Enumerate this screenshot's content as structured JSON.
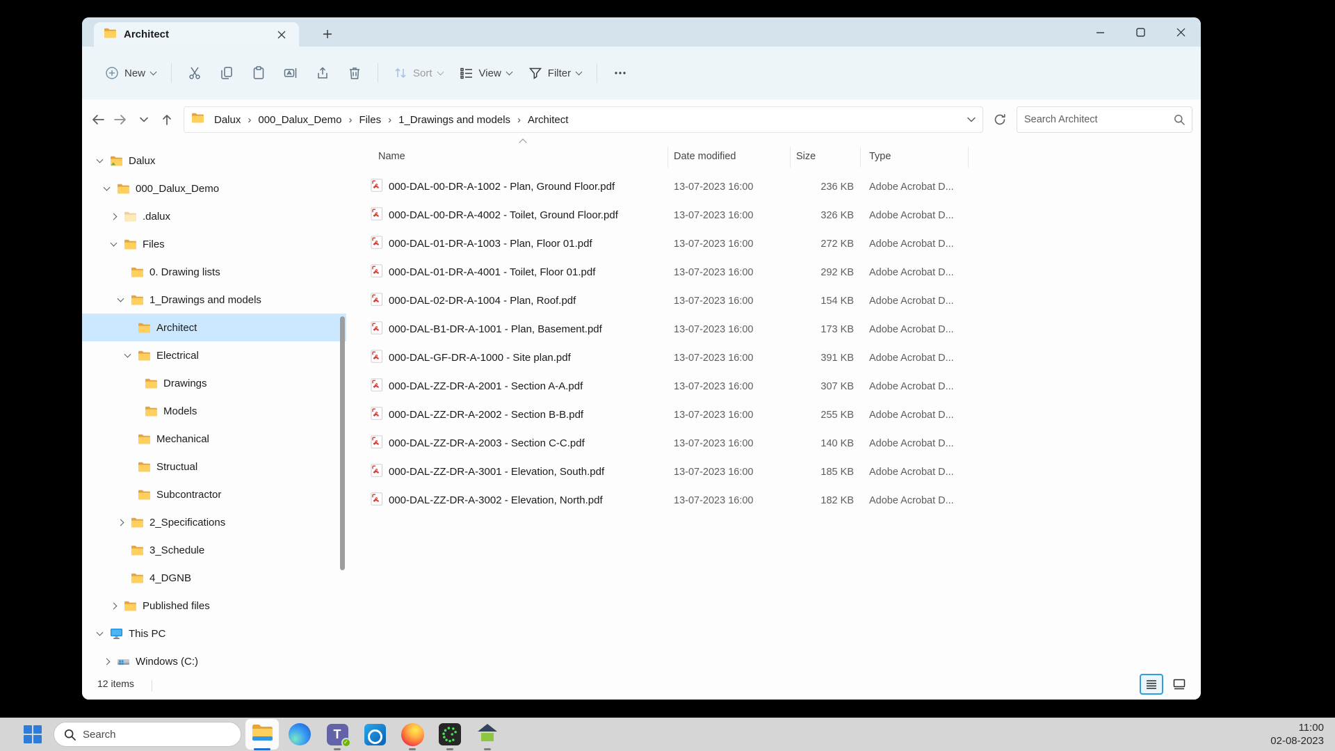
{
  "window": {
    "tab_title": "Architect",
    "new_tab_label": "+",
    "controls": {
      "minimize": "minimize",
      "maximize": "maximize",
      "close": "close"
    }
  },
  "toolbar": {
    "new_label": "New",
    "sort_label": "Sort",
    "view_label": "View",
    "filter_label": "Filter"
  },
  "addressbar": {
    "breadcrumb": [
      "Dalux",
      "000_Dalux_Demo",
      "Files",
      "1_Drawings and models",
      "Architect"
    ],
    "separator": "›",
    "search_placeholder": "Search Architect"
  },
  "sidebar": {
    "items": [
      {
        "label": "Dalux",
        "level": 0,
        "chevron": "down",
        "icon": "folder-sync",
        "selected": false
      },
      {
        "label": "000_Dalux_Demo",
        "level": 1,
        "chevron": "down",
        "icon": "folder",
        "selected": false
      },
      {
        "label": ".dalux",
        "level": 2,
        "chevron": "right",
        "icon": "folder-light",
        "selected": false
      },
      {
        "label": "Files",
        "level": 2,
        "chevron": "down",
        "icon": "folder",
        "selected": false
      },
      {
        "label": "0. Drawing lists",
        "level": 3,
        "chevron": "none",
        "icon": "folder",
        "selected": false
      },
      {
        "label": "1_Drawings and models",
        "level": 3,
        "chevron": "down",
        "icon": "folder",
        "selected": false
      },
      {
        "label": "Architect",
        "level": 4,
        "chevron": "none",
        "icon": "folder",
        "selected": true
      },
      {
        "label": "Electrical",
        "level": 4,
        "chevron": "down",
        "icon": "folder",
        "selected": false
      },
      {
        "label": "Drawings",
        "level": 5,
        "chevron": "none",
        "icon": "folder",
        "selected": false
      },
      {
        "label": "Models",
        "level": 5,
        "chevron": "none",
        "icon": "folder",
        "selected": false
      },
      {
        "label": "Mechanical",
        "level": 4,
        "chevron": "none",
        "icon": "folder",
        "selected": false
      },
      {
        "label": "Structual",
        "level": 4,
        "chevron": "none",
        "icon": "folder",
        "selected": false
      },
      {
        "label": "Subcontractor",
        "level": 4,
        "chevron": "none",
        "icon": "folder",
        "selected": false
      },
      {
        "label": "2_Specifications",
        "level": 3,
        "chevron": "right",
        "icon": "folder",
        "selected": false
      },
      {
        "label": "3_Schedule",
        "level": 3,
        "chevron": "none",
        "icon": "folder",
        "selected": false
      },
      {
        "label": "4_DGNB",
        "level": 3,
        "chevron": "none",
        "icon": "folder",
        "selected": false
      },
      {
        "label": "Published files",
        "level": 2,
        "chevron": "right",
        "icon": "folder",
        "selected": false
      },
      {
        "label": "This PC",
        "level": 0,
        "chevron": "down",
        "icon": "pc",
        "selected": false
      },
      {
        "label": "Windows (C:)",
        "level": 1,
        "chevron": "right",
        "icon": "drive",
        "selected": false
      }
    ]
  },
  "filelist": {
    "columns": {
      "name": "Name",
      "date": "Date modified",
      "size": "Size",
      "type": "Type"
    },
    "rows": [
      {
        "name": "000-DAL-00-DR-A-1002 - Plan, Ground Floor.pdf",
        "date": "13-07-2023 16:00",
        "size": "236 KB",
        "type": "Adobe Acrobat D..."
      },
      {
        "name": "000-DAL-00-DR-A-4002 - Toilet, Ground Floor.pdf",
        "date": "13-07-2023 16:00",
        "size": "326 KB",
        "type": "Adobe Acrobat D..."
      },
      {
        "name": "000-DAL-01-DR-A-1003 - Plan, Floor 01.pdf",
        "date": "13-07-2023 16:00",
        "size": "272 KB",
        "type": "Adobe Acrobat D..."
      },
      {
        "name": "000-DAL-01-DR-A-4001 - Toilet, Floor 01.pdf",
        "date": "13-07-2023 16:00",
        "size": "292 KB",
        "type": "Adobe Acrobat D..."
      },
      {
        "name": "000-DAL-02-DR-A-1004 - Plan, Roof.pdf",
        "date": "13-07-2023 16:00",
        "size": "154 KB",
        "type": "Adobe Acrobat D..."
      },
      {
        "name": "000-DAL-B1-DR-A-1001 - Plan, Basement.pdf",
        "date": "13-07-2023 16:00",
        "size": "173 KB",
        "type": "Adobe Acrobat D..."
      },
      {
        "name": "000-DAL-GF-DR-A-1000 - Site plan.pdf",
        "date": "13-07-2023 16:00",
        "size": "391 KB",
        "type": "Adobe Acrobat D..."
      },
      {
        "name": "000-DAL-ZZ-DR-A-2001 - Section A-A.pdf",
        "date": "13-07-2023 16:00",
        "size": "307 KB",
        "type": "Adobe Acrobat D..."
      },
      {
        "name": "000-DAL-ZZ-DR-A-2002 - Section B-B.pdf",
        "date": "13-07-2023 16:00",
        "size": "255 KB",
        "type": "Adobe Acrobat D..."
      },
      {
        "name": "000-DAL-ZZ-DR-A-2003 - Section  C-C.pdf",
        "date": "13-07-2023 16:00",
        "size": "140 KB",
        "type": "Adobe Acrobat D..."
      },
      {
        "name": "000-DAL-ZZ-DR-A-3001 - Elevation, South.pdf",
        "date": "13-07-2023 16:00",
        "size": "185 KB",
        "type": "Adobe Acrobat D..."
      },
      {
        "name": "000-DAL-ZZ-DR-A-3002 - Elevation, North.pdf",
        "date": "13-07-2023 16:00",
        "size": "182 KB",
        "type": "Adobe Acrobat D..."
      }
    ]
  },
  "statusbar": {
    "item_count": "12 items"
  },
  "taskbar": {
    "search_label": "Search",
    "clock_time": "11:00",
    "clock_date": "02-08-2023"
  },
  "colors": {
    "titlebar": "#d4e3ec",
    "toolbar": "#eef5f9",
    "selection": "#cce8ff",
    "accent_underline": "#1e6fd0",
    "active_view_border": "#2f9be0",
    "taskbar": "#d6d6d6"
  }
}
